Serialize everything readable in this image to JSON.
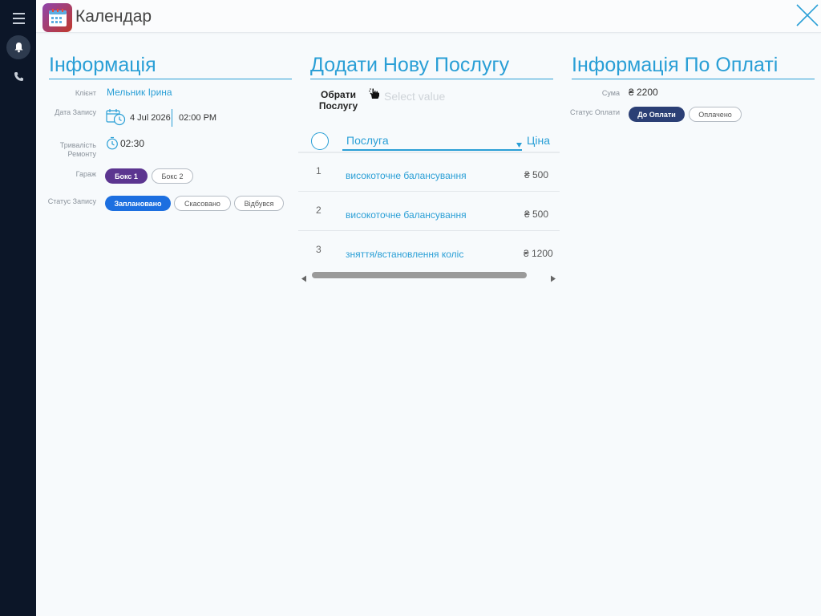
{
  "app": {
    "title": "Календар",
    "app_icon": "calendar-app-icon",
    "accent_color": "#2a9fd6"
  },
  "rail": {
    "items": [
      "menu-icon",
      "bell-icon",
      "phone-icon"
    ]
  },
  "info": {
    "title": "Інформація",
    "client_label": "Клієнт",
    "client_value": "Мельник Ірина",
    "date_label": "Дата Запису",
    "date_value": "4 Jul 2026",
    "time_value": "02:00 PM",
    "duration_label_1": "Тривалість",
    "duration_label_2": "Ремонту",
    "duration_value": "02:30",
    "garage_label": "Гараж",
    "garage_options": [
      "Бокс 1",
      "Бокс 2"
    ],
    "garage_selected": "Бокс 1",
    "status_label": "Статус Запису",
    "status_options": [
      "Заплановано",
      "Скасовано",
      "Відбувся"
    ],
    "status_selected": "Заплановано"
  },
  "add_service": {
    "title": "Додати Нову Послугу",
    "select_label_1": "Обрати",
    "select_label_2": "Послугу",
    "select_placeholder": "Select value",
    "columns": {
      "service": "Послуга",
      "price": "Ціна"
    },
    "rows": [
      {
        "num": "1",
        "service": "високоточне балансування",
        "price": "₴ 500"
      },
      {
        "num": "2",
        "service": "високоточне балансування",
        "price": "₴ 500"
      },
      {
        "num": "3",
        "service": "зняття/встановлення коліс",
        "price": "₴ 1200"
      }
    ]
  },
  "payment": {
    "title": "Інформація По Оплаті",
    "sum_label": "Сума",
    "sum_value": "₴ 2200",
    "status_label": "Статус Оплати",
    "status_options": [
      "До Оплати",
      "Оплачено"
    ],
    "status_selected": "До Оплати"
  }
}
